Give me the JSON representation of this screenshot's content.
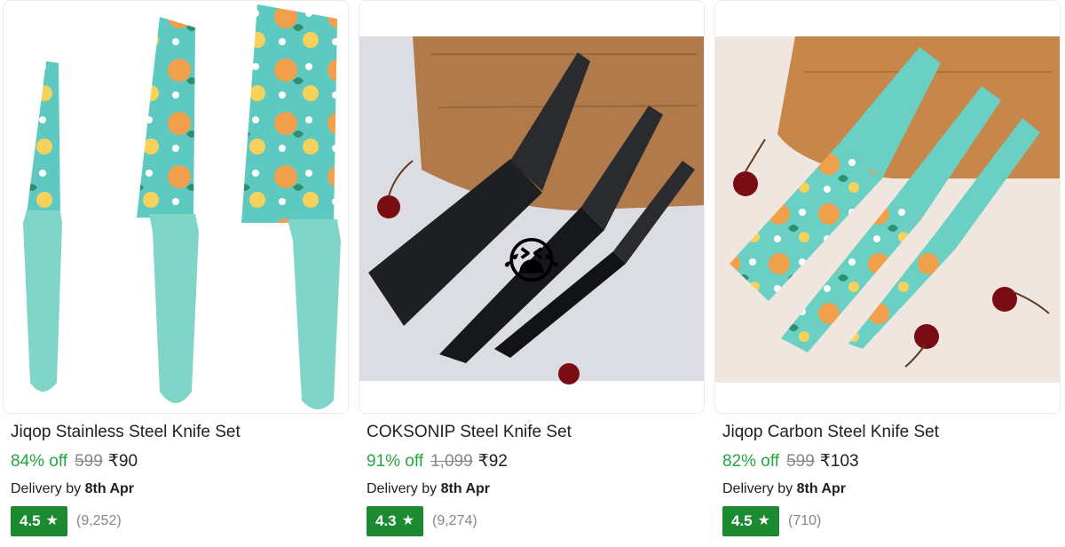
{
  "products": [
    {
      "title": "Jiqop Stainless Steel Knife Set",
      "discount": "84% off",
      "mrp": "599",
      "price": "₹90",
      "delivery_label": "Delivery by",
      "delivery_date": "8th Apr",
      "rating": "4.5",
      "rating_count": "(9,252)",
      "image_icon": "floral-teal-knife-set-image"
    },
    {
      "title": "COKSONIP Steel Knife Set",
      "discount": "91% off",
      "mrp": "1,099",
      "price": "₹92",
      "delivery_label": "Delivery by",
      "delivery_date": "8th Apr",
      "rating": "4.3",
      "rating_count": "(9,274)",
      "image_icon": "black-knife-set-image",
      "overlay_emoji": "😭"
    },
    {
      "title": "Jiqop Carbon Steel Knife Set",
      "discount": "82% off",
      "mrp": "599",
      "price": "₹103",
      "delivery_label": "Delivery by",
      "delivery_date": "8th Apr",
      "rating": "4.5",
      "rating_count": "(710)",
      "image_icon": "floral-teal-knife-set-on-board-image"
    }
  ],
  "colors": {
    "discount_green": "#26a541",
    "rating_badge": "#1b8a30",
    "muted_gray": "#878787",
    "knife_teal": "#7fd6c8",
    "orange_fruit": "#f0a04a"
  }
}
